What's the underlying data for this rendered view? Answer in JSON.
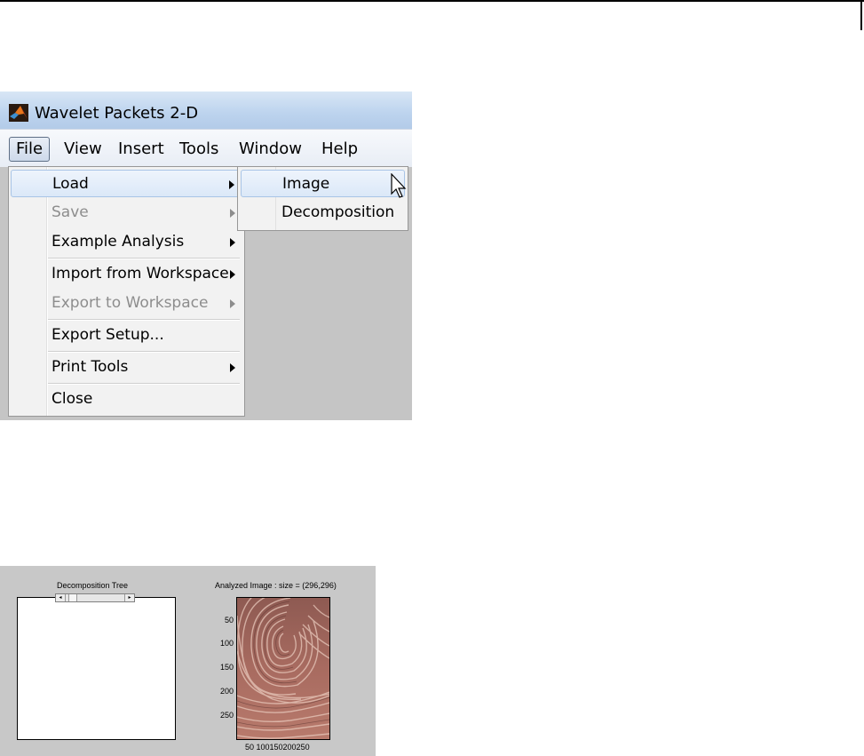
{
  "window": {
    "title": "Wavelet Packets 2-D"
  },
  "menubar": {
    "items": [
      "File",
      "View",
      "Insert",
      "Tools",
      "Window",
      "Help"
    ],
    "open_item": "File"
  },
  "file_menu": {
    "items": [
      {
        "label": "Load",
        "has_submenu": true,
        "enabled": true,
        "highlighted": true
      },
      {
        "label": "Save",
        "has_submenu": true,
        "enabled": false
      },
      {
        "label": "Example Analysis",
        "has_submenu": true,
        "enabled": true
      },
      {
        "label": "Import from Workspace",
        "has_submenu": true,
        "enabled": true
      },
      {
        "label": "Export to Workspace",
        "has_submenu": true,
        "enabled": false
      },
      {
        "label": "Export Setup...",
        "has_submenu": false,
        "enabled": true
      },
      {
        "label": "Print Tools",
        "has_submenu": true,
        "enabled": true
      },
      {
        "label": "Close",
        "has_submenu": false,
        "enabled": true
      }
    ]
  },
  "load_submenu": {
    "items": [
      {
        "label": "Image",
        "highlighted": true
      },
      {
        "label": "Decomposition"
      }
    ]
  },
  "panel": {
    "tree_title": "Decomposition Tree",
    "image_title": "Analyzed Image : size = (296,296)",
    "y_ticks": [
      "50",
      "100",
      "150",
      "200",
      "250"
    ],
    "x_ticks": "50 100150200250"
  },
  "colors": {
    "menu_highlight": "#dbe8f8",
    "disabled_text": "#8d8d8d",
    "panel_bg": "#c8c8c8"
  }
}
